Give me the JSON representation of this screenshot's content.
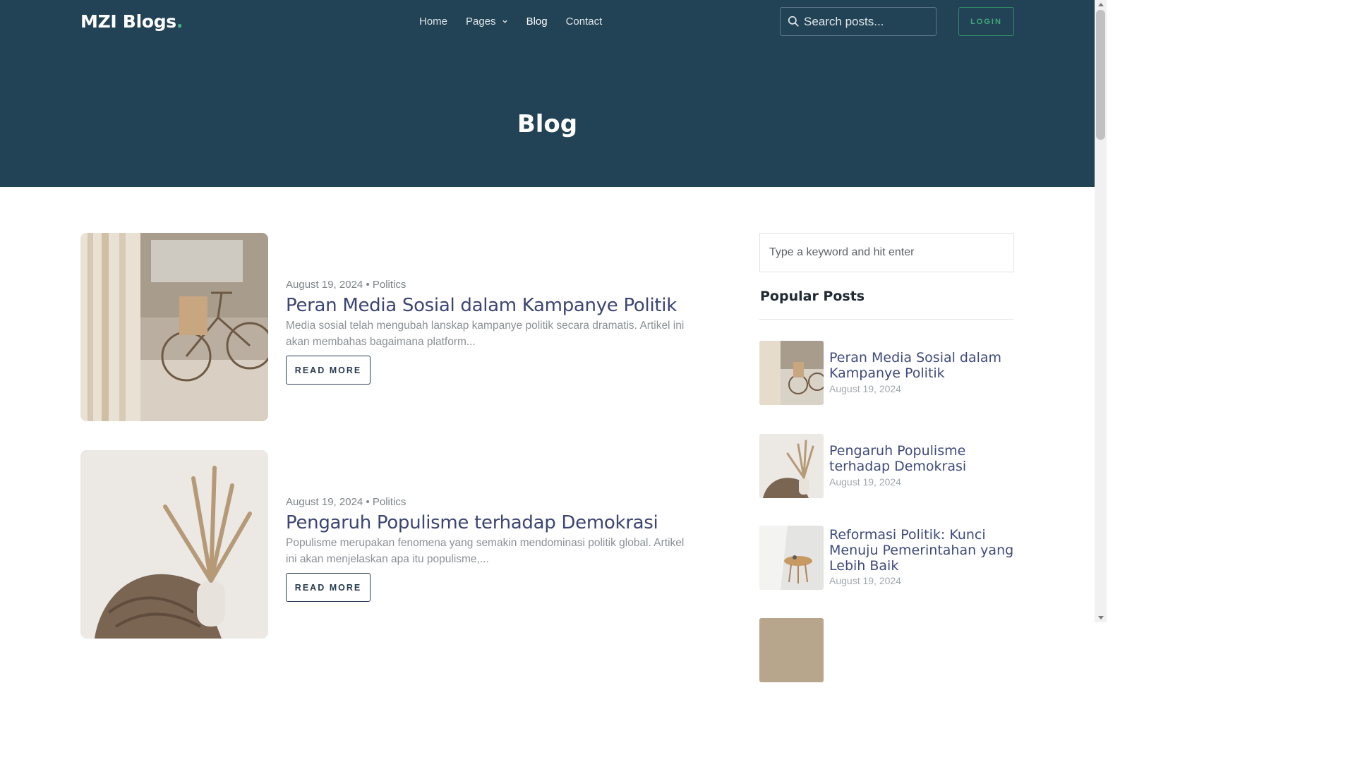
{
  "header": {
    "logo": "MZI Blogs",
    "logo_dot": ".",
    "nav": [
      {
        "label": "Home"
      },
      {
        "label": "Pages"
      },
      {
        "label": "Blog"
      },
      {
        "label": "Contact"
      }
    ],
    "search_placeholder": "Search posts...",
    "login_label": "LOGIN"
  },
  "hero": {
    "title": "Blog"
  },
  "posts": [
    {
      "date": "August 19, 2024",
      "separator": "•",
      "category": "Politics",
      "title": "Peran Media Sosial dalam Kampanye Politik",
      "excerpt": "Media sosial telah mengubah lanskap kampanye politik secara dramatis. Artikel ini akan membahas bagaimana platform...",
      "button": "READ MORE"
    },
    {
      "date": "August 19, 2024",
      "separator": "•",
      "category": "Politics",
      "title": "Pengaruh Populisme terhadap Demokrasi",
      "excerpt": "Populisme merupakan fenomena yang semakin mendominasi politik global. Artikel ini akan menjelaskan apa itu populisme,...",
      "button": "READ MORE"
    }
  ],
  "sidebar": {
    "search_placeholder": "Type a keyword and hit enter",
    "popular_title": "Popular Posts",
    "popular": [
      {
        "title": "Peran Media Sosial dalam Kampanye Politik",
        "date": "August 19, 2024"
      },
      {
        "title": "Pengaruh Populisme terhadap Demokrasi",
        "date": "August 19, 2024"
      },
      {
        "title": "Reformasi Politik: Kunci Menuju Pemerintahan yang Lebih Baik",
        "date": "August 19, 2024"
      }
    ]
  },
  "colors": {
    "header_bg": "#224255",
    "accent_green": "#3fa97b",
    "title_blue": "#3c4573"
  },
  "icons": [
    "search-icon",
    "chevron-down-icon"
  ]
}
